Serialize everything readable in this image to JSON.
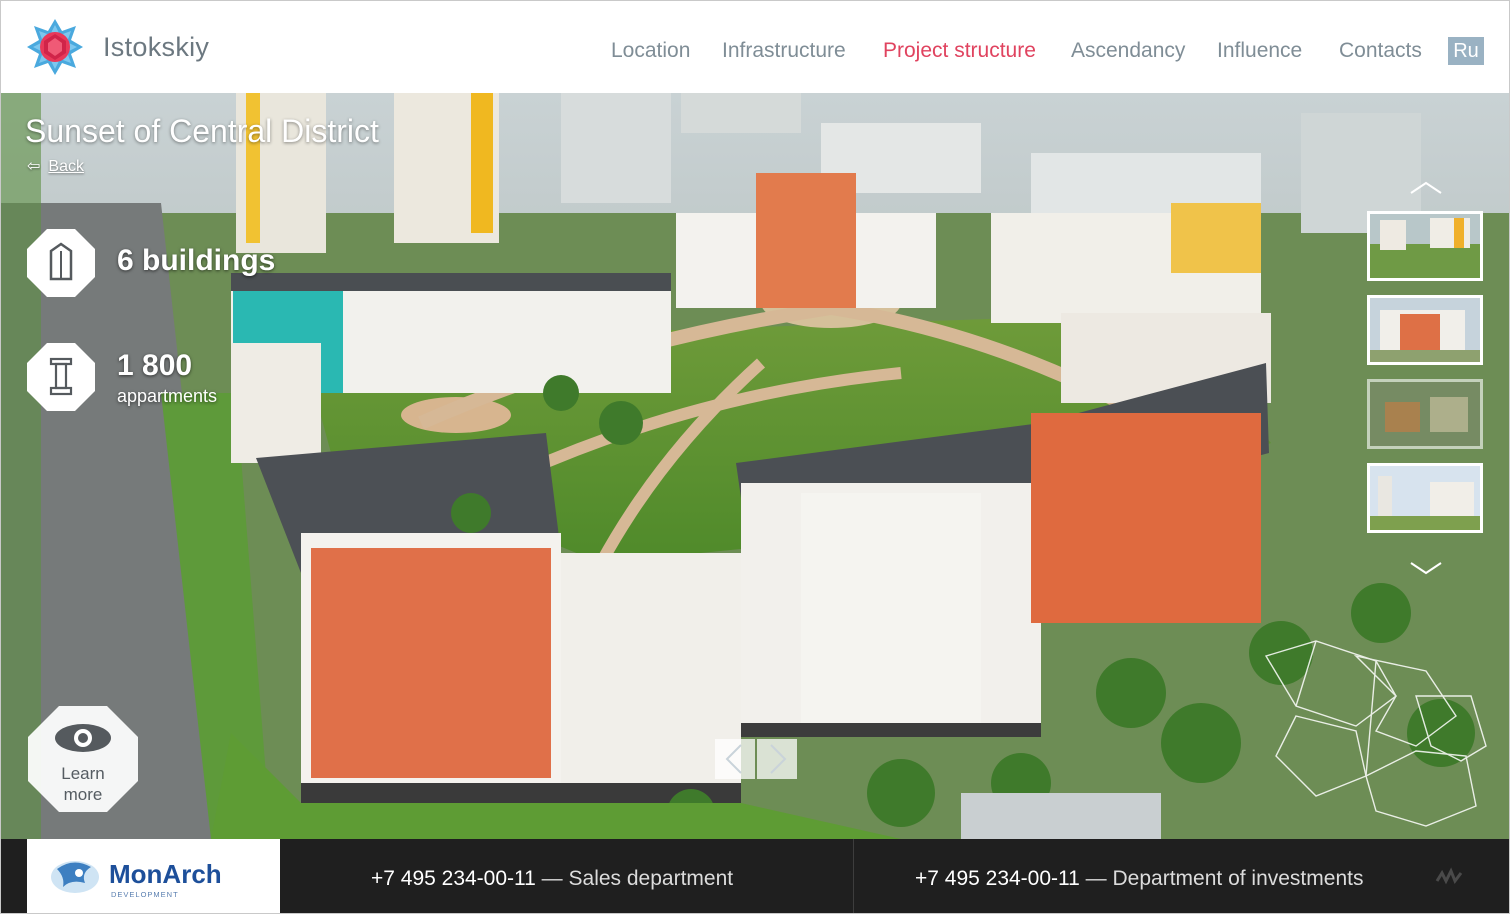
{
  "header": {
    "brand": "Istokskiy",
    "nav": [
      "Location",
      "Infrastructure",
      "Project structure",
      "Ascendancy",
      "Influence",
      "Contacts"
    ],
    "active_nav": "Project structure",
    "lang": "Ru"
  },
  "hero": {
    "title": "Sunset of Central District",
    "back_label": "Back",
    "stats": [
      {
        "value": "6 buildings",
        "label": ""
      },
      {
        "value": "1 800",
        "label": "appartments"
      }
    ],
    "learn_more": [
      "Learn",
      "more"
    ]
  },
  "thumbnails": {
    "count": 4,
    "selected_index": 1
  },
  "footer": {
    "logo_name": "MonArch",
    "logo_sub": "DEVELOPMENT",
    "contacts": [
      {
        "phone": "+7 495 234-00-11",
        "dept": " — Sales department"
      },
      {
        "phone": "+7 495 234-00-11",
        "dept": " — Department of investments"
      }
    ]
  },
  "colors": {
    "accent": "#e0435f",
    "nav_text": "#7f8d96",
    "lang_bg": "#9ab2c3",
    "footer_bg": "#1f1f1f"
  },
  "icons": {
    "logo": "geometric-star-icon",
    "buildings": "building-icon",
    "apartments": "column-icon",
    "learn_more": "eye-icon",
    "thumb_up": "chevron-up-icon",
    "thumb_down": "chevron-down-icon",
    "prev": "chevron-left-icon",
    "next": "chevron-right-icon"
  }
}
